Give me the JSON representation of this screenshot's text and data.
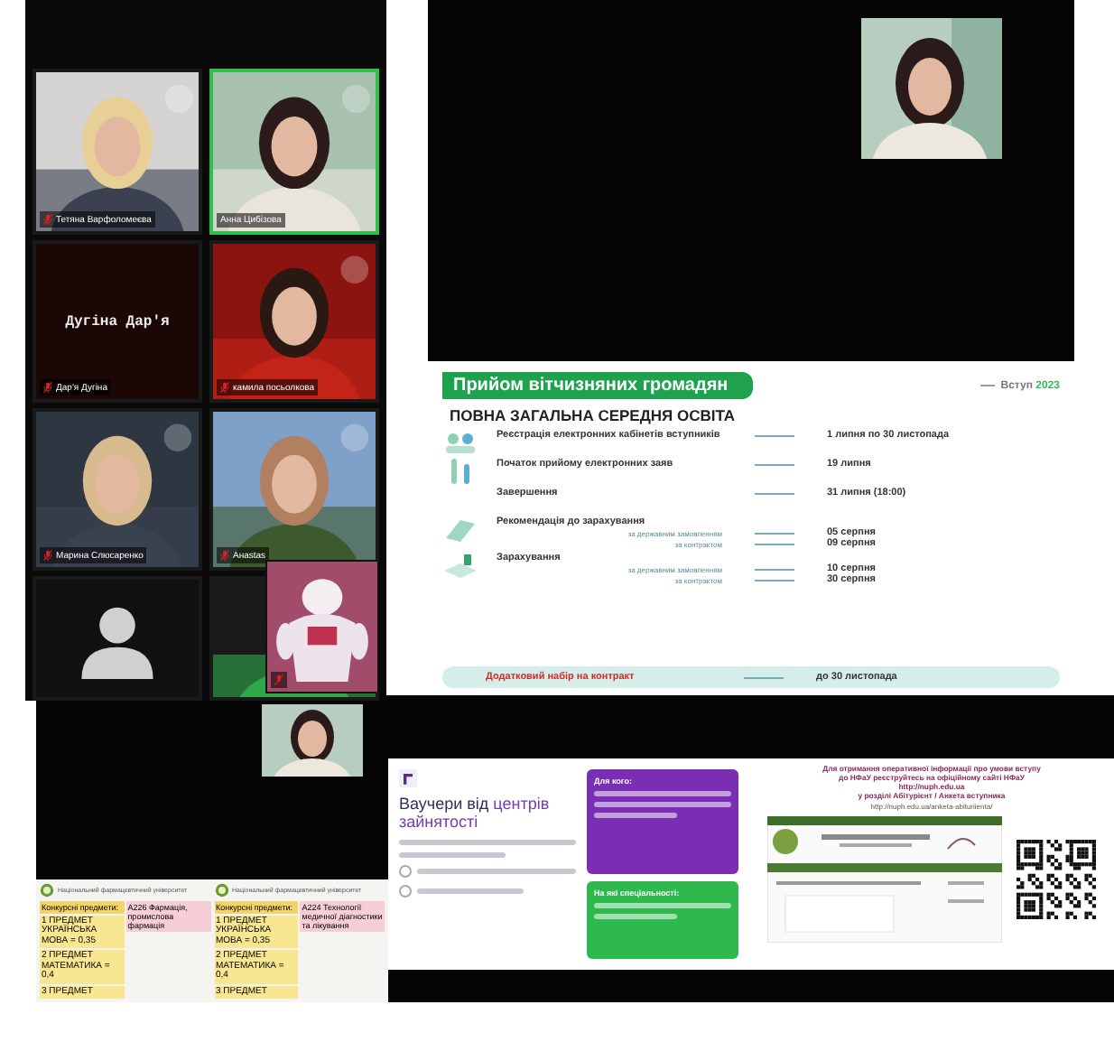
{
  "gallery": {
    "tiles": [
      {
        "kind": "video",
        "name": "Тетяна Варфоломеєва",
        "muted": true,
        "speaking": false
      },
      {
        "kind": "video",
        "name": "Анна Цибізова",
        "muted": false,
        "speaking": true
      },
      {
        "kind": "name_card",
        "card_text": "Дугіна Дар'я",
        "name": "Дар'я Дугіна",
        "muted": true,
        "speaking": false
      },
      {
        "kind": "video",
        "name": "камила посьолкова",
        "muted": true,
        "speaking": false
      },
      {
        "kind": "video",
        "name": "Марина Слюсаренко",
        "muted": true,
        "speaking": false
      },
      {
        "kind": "video",
        "name": "Анаstas",
        "muted": true,
        "speaking": false
      },
      {
        "kind": "avatar",
        "muted": false,
        "speaking": false
      },
      {
        "kind": "video",
        "muted": false,
        "speaking": false
      }
    ],
    "overlay_tile": {
      "kind": "video",
      "muted": true
    }
  },
  "main_slide": {
    "header": "Прийом вітчизняних громадян",
    "brand": "Вступ",
    "year": "2023",
    "title": "ПОВНА ЗАГАЛЬНА СЕРЕДНЯ ОСВІТА",
    "steps": [
      {
        "label": "Реєстрація електронних кабінетів вступників",
        "value": "1 липня по 30 листопада"
      },
      {
        "label": "Початок прийому електронних заяв",
        "value": "19 липня"
      },
      {
        "label": "Завершення",
        "value": "31 липня (18:00)"
      },
      {
        "label": "Рекомендація до зарахування",
        "subs": [
          {
            "label": "за державним замовленням",
            "value": "05 серпня"
          },
          {
            "label": "за контрактом",
            "value": "09 серпня"
          }
        ]
      },
      {
        "label": "Зарахування",
        "subs": [
          {
            "label": "за державним замовленням",
            "value": "10 серпня"
          },
          {
            "label": "за контрактом",
            "value": "30 серпня"
          }
        ]
      }
    ],
    "footer": {
      "label": "Додатковий набір на контракт",
      "value": "до 30 листопада"
    }
  },
  "program_slide": {
    "blocks": [
      {
        "university": "Національний фармацевтичний університет",
        "columns": [
          {
            "kind": "subjects",
            "heading": "Конкурсні предмети:",
            "items": [
              "1 ПРЕДМЕТ УКРАЇНСЬКА МОВА = 0,35",
              "2 ПРЕДМЕТ МАТЕМАТИКА = 0,4",
              "3 ПРЕДМЕТ"
            ]
          },
          {
            "kind": "specialty",
            "heading": "А226 Фармація, промислова фармація"
          }
        ]
      },
      {
        "university": "Національний фармацевтичний університет",
        "columns": [
          {
            "kind": "subjects",
            "heading": "Конкурсні предмети:",
            "items": [
              "1 ПРЕДМЕТ УКРАЇНСЬКА МОВА = 0,35",
              "2 ПРЕДМЕТ МАТЕМАТИКА = 0,4",
              "3 ПРЕДМЕТ"
            ]
          },
          {
            "kind": "specialty",
            "heading": "А224 Технології медичної діагностики та лікування"
          }
        ]
      }
    ]
  },
  "voucher_slide": {
    "title": "Ваучери від ",
    "title_accent": "центрів зайнятості",
    "purple_card": {
      "heading": "Для кого:"
    },
    "green_card": {
      "heading": "На які спеціальності:"
    }
  },
  "info_slide": {
    "lines": [
      "Для отримання оперативної інформації про умови вступу",
      "до НФаУ реєструйтесь на офіційному сайті НФаУ",
      "http://nuph.edu.ua",
      "у розділі Абітурієнт / Анкета вступника"
    ],
    "link": "http://nuph.edu.ua/anketa-abituriienta/"
  }
}
